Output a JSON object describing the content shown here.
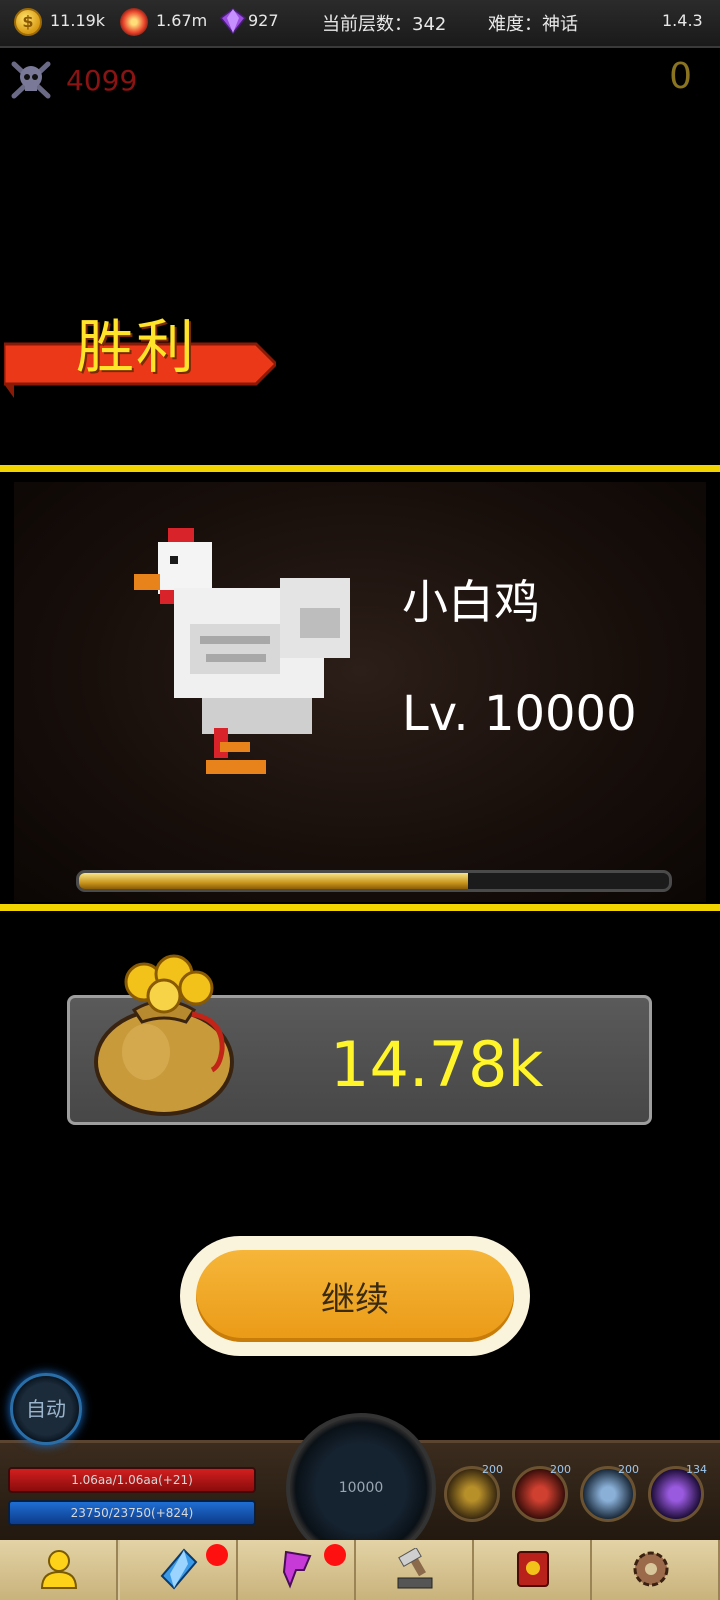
{
  "topbar": {
    "gold": "11.19k",
    "power": "1.67m",
    "gems": "927",
    "floor_label": "当前层数：342",
    "difficulty_label": "难度：神话",
    "version": "1.4.3"
  },
  "kills": "4099",
  "score": "0",
  "victory_text": "胜利",
  "monster": {
    "name": "小白鸡",
    "level": "Lv. 10000",
    "xp_fraction": 0.66
  },
  "reward": {
    "amount": "14.78k"
  },
  "continue_label": "继续",
  "hud": {
    "auto_label": "自动",
    "hp": "1.06aa/1.06aa(+21)",
    "mp": "23750/23750(+824)",
    "center_value": "10000",
    "skills": [
      {
        "count": "200",
        "icon": "holy-cross-icon"
      },
      {
        "count": "200",
        "icon": "warrior-icon"
      },
      {
        "count": "200",
        "icon": "storm-icon"
      },
      {
        "count": "134",
        "icon": "arcane-icon"
      }
    ]
  },
  "tabs": [
    {
      "icon": "hero-icon",
      "badge": false
    },
    {
      "icon": "crystal-icon",
      "badge": true
    },
    {
      "icon": "rune-icon",
      "badge": true
    },
    {
      "icon": "forge-icon",
      "badge": false
    },
    {
      "icon": "spellbook-icon",
      "badge": false
    },
    {
      "icon": "settings-gear-icon",
      "badge": false
    }
  ],
  "colors": {
    "victory_yellow": "#ffe42a",
    "divider_yellow": "#f2d400",
    "reward_text": "#fff52a",
    "continue_orange": "#ea9a16",
    "kills_red": "#8a1313"
  }
}
